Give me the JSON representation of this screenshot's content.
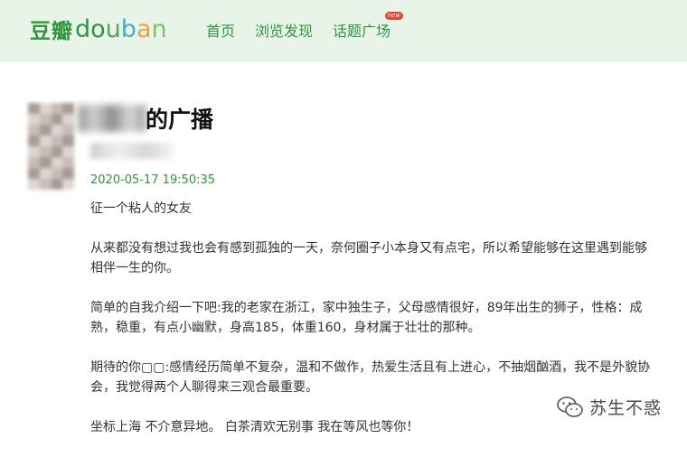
{
  "header": {
    "logo_cn": "豆瓣",
    "logo_en_letters": [
      {
        "ch": "d",
        "color": "#2e963d"
      },
      {
        "ch": "o",
        "color": "#2e963d"
      },
      {
        "ch": "u",
        "color": "#4aa85a"
      },
      {
        "ch": "b",
        "color": "#3cb0c9"
      },
      {
        "ch": "a",
        "color": "#f2a133"
      },
      {
        "ch": "n",
        "color": "#7cc26b"
      }
    ],
    "nav": [
      {
        "label": "首页"
      },
      {
        "label": "浏览发现"
      },
      {
        "label": "话题广场",
        "badge": "new"
      }
    ]
  },
  "post": {
    "title_suffix": "的广播",
    "timestamp": "2020-05-17 19:50:35",
    "paragraphs": [
      "征一个粘人的女友",
      "从来都没有想过我也会有感到孤独的一天，奈何圈子小本身又有点宅，所以希望能够在这里遇到能够相伴一生的你。",
      "简单的自我介绍一下吧:我的老家在浙江，家中独生子，父母感情很好，89年出生的狮子，性格：成熟，稳重，有点小幽默，身高185，体重160，身材属于壮壮的那种。",
      "期待的你▢▢:感情经历简单不复杂，温和不做作，热爱生活且有上进心，不抽烟酗酒，我不是外貌协会，我觉得两个人聊得来三观合最重要。",
      "坐标上海 不介意异地。 白茶清欢无别事 我在等风也等你！"
    ]
  },
  "watermark": {
    "text": "苏生不惑",
    "icon": "wechat-icon"
  },
  "colors": {
    "brand_green": "#2e963d",
    "header_bg": "#e9f4e9"
  }
}
